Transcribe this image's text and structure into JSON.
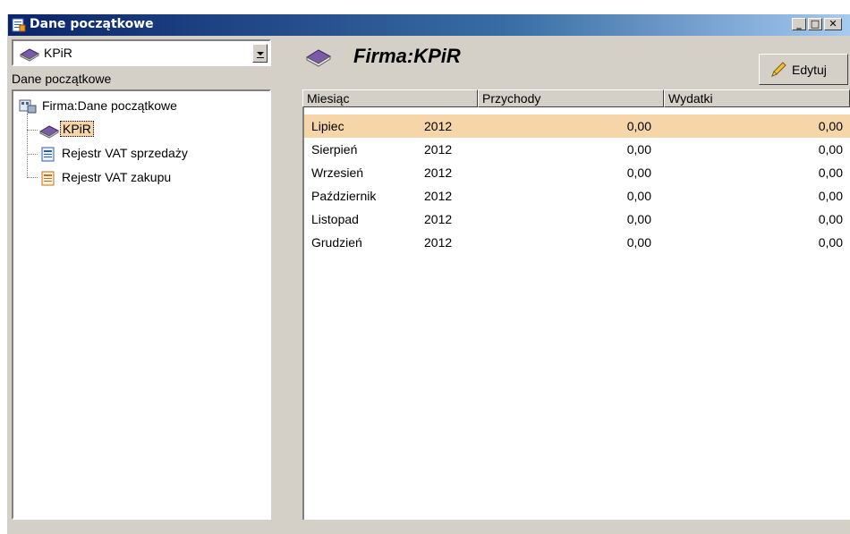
{
  "window": {
    "title": "Dane początkowe"
  },
  "left": {
    "combo_value": "KPiR",
    "section_label": "Dane początkowe",
    "tree": {
      "root": "Firma:Dane początkowe",
      "children": [
        {
          "label": "KPiR",
          "icon": "book-icon",
          "selected": true
        },
        {
          "label": "Rejestr VAT sprzedaży",
          "icon": "register-icon"
        },
        {
          "label": "Rejestr VAT zakupu",
          "icon": "register-icon"
        }
      ]
    }
  },
  "right": {
    "title": "Firma:KPiR",
    "edit_label": "Edytuj",
    "columns": [
      "Miesiąc",
      "Przychody",
      "Wydatki"
    ],
    "rows": [
      {
        "month": "Lipiec",
        "year": "2012",
        "income": "0,00",
        "expenses": "0,00",
        "selected": true
      },
      {
        "month": "Sierpień",
        "year": "2012",
        "income": "0,00",
        "expenses": "0,00"
      },
      {
        "month": "Wrzesień",
        "year": "2012",
        "income": "0,00",
        "expenses": "0,00"
      },
      {
        "month": "Październik",
        "year": "2012",
        "income": "0,00",
        "expenses": "0,00"
      },
      {
        "month": "Listopad",
        "year": "2012",
        "income": "0,00",
        "expenses": "0,00"
      },
      {
        "month": "Grudzień",
        "year": "2012",
        "income": "0,00",
        "expenses": "0,00"
      }
    ]
  },
  "colors": {
    "selection": "#f6d6a9",
    "titlebar": "#0a246a",
    "face": "#d4d0c8"
  }
}
